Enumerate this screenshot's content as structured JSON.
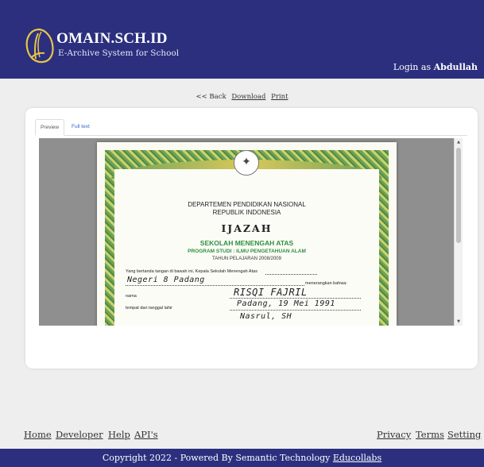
{
  "header": {
    "brand_title": "OMAIN.SCH.ID",
    "brand_subtitle": "E-Archive System for School",
    "login_prefix": "Login as",
    "login_user": "Abdullah",
    "colors": {
      "header_bg": "#2b2f7e",
      "logo_color": "#e8c548"
    }
  },
  "actions": {
    "back": "<< Back",
    "download": "Download",
    "print": "Print"
  },
  "tabs": [
    {
      "label": "Preview"
    },
    {
      "label": "Full text"
    }
  ],
  "document": {
    "dept": "DEPARTEMEN PENDIDIKAN NASIONAL",
    "republic": "REPUBLIK INDONESIA",
    "title": "IJAZAH",
    "school": "SEKOLAH MENENGAH ATAS",
    "program": "PROGRAM STUDI : ILMU PENGETAHUAN ALAM",
    "year": "TAHUN PELAJARAN 2008/2009",
    "line1": "Yang bertanda tangan di bawah ini, Kepala Sekolah Menengah Atas",
    "handwritten_school": "Negeri 8 Padang",
    "line2": "menerangkan bahwa:",
    "label_name": "nama",
    "handwritten_name": "RISQI FAJRIL",
    "label_birth": "tempat dan tanggal lahir",
    "handwritten_birth": "Padang, 19 Mei 1991",
    "handwritten_parent": "Nasrul, SH"
  },
  "footer": {
    "left_links": [
      "Home",
      "Developer",
      "Help",
      "API's"
    ],
    "right_links": [
      "Privacy",
      "Terms",
      "Setting"
    ],
    "copyright": "Copyright 2022 - Powered By Semantic Technology",
    "copyright_link": "Educollabs"
  }
}
